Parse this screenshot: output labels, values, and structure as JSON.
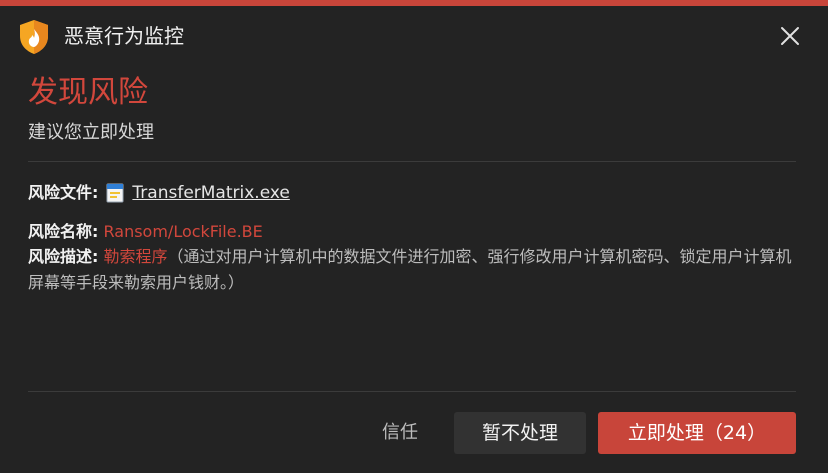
{
  "window": {
    "title": "恶意行为监控",
    "accent_color": "#c8453a",
    "app_icon": "shield-flame-icon",
    "close_icon": "close-icon"
  },
  "header": {
    "headline": "发现风险",
    "subline": "建议您立即处理"
  },
  "details": {
    "file_label": "风险文件:",
    "file_icon": "executable-file-icon",
    "file_name": "TransferMatrix.exe",
    "name_label": "风险名称:",
    "name_value": "Ransom/LockFile.BE",
    "desc_label": "风险描述:",
    "desc_type": "勒索程序",
    "desc_text": "（通过对用户计算机中的数据文件进行加密、强行修改用户计算机密码、锁定用户计算机屏幕等手段来勒索用户钱财。）"
  },
  "actions": {
    "trust_label": "信任",
    "later_label": "暂不处理",
    "now_label": "立即处理（24）"
  }
}
